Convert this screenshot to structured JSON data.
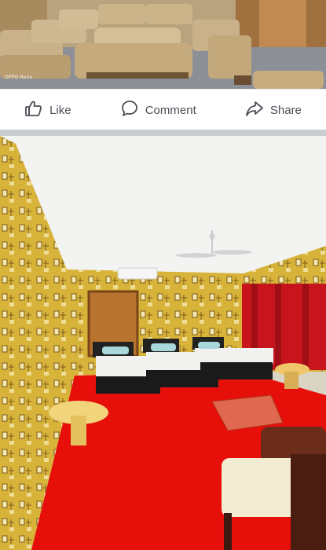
{
  "top_photo": {
    "caption": "OPPO Reno",
    "alt": "hotel lobby with sofas"
  },
  "actions": {
    "like_label": "Like",
    "comment_label": "Comment",
    "share_label": "Share",
    "like_icon": "thumbs-up-icon",
    "comment_icon": "comment-bubble-icon",
    "share_icon": "share-arrow-icon"
  },
  "bottom_photo": {
    "alt": "hotel room with three beds and red carpet"
  },
  "colors": {
    "action_text": "#4b4f56",
    "separator": "#c9ccd1",
    "carpet": "#e60f0a",
    "wall": "#d9b53b"
  }
}
